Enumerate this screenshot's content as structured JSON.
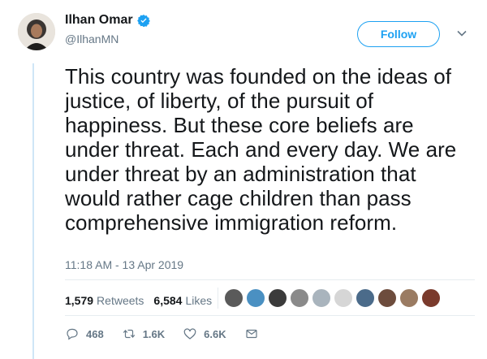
{
  "author": {
    "display_name": "Ilhan Omar",
    "handle": "@IlhanMN",
    "verified": true
  },
  "follow_label": "Follow",
  "tweet_text": "This country was founded on the ideas of\njustice, of liberty, of the pursuit of\nhappiness. But these core beliefs are\nunder threat. Each and every day. We are\nunder threat by an administration that\nwould rather cage children than pass\ncomprehensive immigration reform.",
  "timestamp": "11:18 AM - 13 Apr 2019",
  "stats": {
    "retweets_count": "1,579",
    "retweets_label": "Retweets",
    "likes_count": "6,584",
    "likes_label": "Likes"
  },
  "liker_avatars": [
    "#5a5a5a",
    "#4a90c2",
    "#3b3b3b",
    "#8a8a8a",
    "#a9b4bd",
    "#d6d6d6",
    "#4b6b8a",
    "#6d4c3d",
    "#9a7b62",
    "#7a3a2c"
  ],
  "actions": {
    "replies": "468",
    "retweets": "1.6K",
    "likes": "6.6K"
  },
  "colors": {
    "accent": "#1da1f2",
    "muted": "#657786",
    "text": "#14171a"
  }
}
